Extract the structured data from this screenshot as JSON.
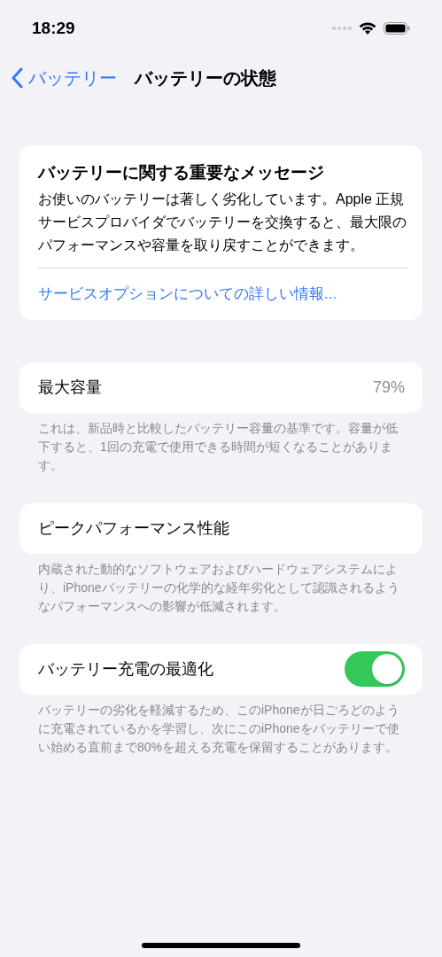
{
  "status_bar": {
    "time": "18:29"
  },
  "nav": {
    "back_label": "バッテリー",
    "title": "バッテリーの状態"
  },
  "message": {
    "title": "バッテリーに関する重要なメッセージ",
    "body": "お使いのバッテリーは著しく劣化しています。Apple 正規サービスプロバイダでバッテリーを交換すると、最大限のパフォーマンスや容量を取り戻すことができます。",
    "link": "サービスオプションについての詳しい情報..."
  },
  "settings": [
    {
      "kind": "value",
      "label": "最大容量",
      "value": "79%",
      "footer": "これは、新品時と比較したバッテリー容量の基準です。容量が低下すると、1回の充電で使用できる時間が短くなることがあります。"
    },
    {
      "kind": "plain",
      "label": "ピークパフォーマンス性能",
      "footer": "内蔵された動的なソフトウェアおよびハードウェアシステムにより、iPhoneバッテリーの化学的な経年劣化として認識されるようなパフォーマンスへの影響が低減されます。"
    },
    {
      "kind": "toggle",
      "label": "バッテリー充電の最適化",
      "on": true,
      "footer": "バッテリーの劣化を軽減するため、このiPhoneが日ごろどのように充電されているかを学習し、次にこのiPhoneをバッテリーで使い始める直前まで80%を超える充電を保留することがあります。"
    }
  ]
}
